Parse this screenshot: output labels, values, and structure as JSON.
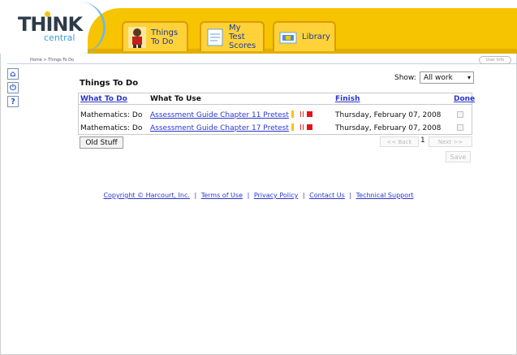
{
  "header": {
    "logo_think": "THINK",
    "logo_central": "central",
    "tabs": [
      {
        "line1": "Things",
        "line2": "To Do"
      },
      {
        "line1": "My Test",
        "line2": "Scores"
      },
      {
        "line1": "Library",
        "line2": ""
      }
    ]
  },
  "breadcrumb": "Home > Things To Do",
  "user_info": "User Info",
  "page_title": "Things To Do",
  "show": {
    "label": "Show:",
    "selected": "All work"
  },
  "table": {
    "headers": {
      "what_to_do": "What To Do",
      "what_to_use": "What To Use",
      "finish": "Finish",
      "done": "Done"
    },
    "rows": [
      {
        "what_to_do": "Mathematics: Do",
        "what_to_use": "Assessment Guide Chapter 11 Pretest",
        "finish": "Thursday, February 07, 2008"
      },
      {
        "what_to_do": "Mathematics: Do",
        "what_to_use": "Assessment Guide Chapter 17 Pretest",
        "finish": "Thursday, February 07, 2008"
      }
    ]
  },
  "buttons": {
    "old_stuff": "Old Stuff",
    "back": "<< Back",
    "next": "Next >>",
    "save": "Save"
  },
  "pager": {
    "page": "1"
  },
  "footer": {
    "copyright": "Copyright © Harcourt, Inc.",
    "terms": "Terms of Use",
    "privacy": "Privacy Policy",
    "contact": "Contact Us",
    "support": "Technical Support",
    "separator": "|"
  },
  "colors": {
    "brand_yellow": "#f6c400",
    "link_blue": "#2b36d0",
    "stop_red": "#e2141a"
  }
}
